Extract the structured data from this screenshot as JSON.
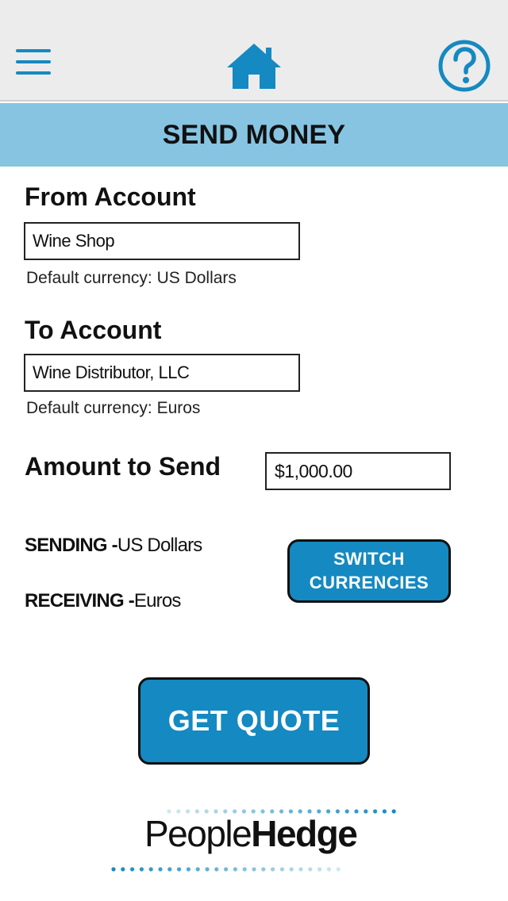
{
  "header": {
    "menu_icon": "hamburger-menu-icon",
    "home_icon": "house-icon",
    "help_icon": "question-mark-circle-icon",
    "icon_color": "#1589c1"
  },
  "title": "SEND MONEY",
  "from_account": {
    "label": "From Account",
    "value": "Wine Shop",
    "hint": "Default currency: US Dollars"
  },
  "to_account": {
    "label": "To Account",
    "value": "Wine Distributor, LLC",
    "hint": "Default currency: Euros"
  },
  "amount": {
    "label": "Amount to Send",
    "value": "$1,000.00"
  },
  "currencies": {
    "sending_label": "SENDING -",
    "sending_value": "US Dollars",
    "receiving_label": "RECEIVING -",
    "receiving_value": "Euros"
  },
  "switch_button": {
    "line1": "SWITCH",
    "line2": "CURRENCIES"
  },
  "quote_button": "GET QUOTE",
  "logo": {
    "part1": "People",
    "part2": "Hedge"
  },
  "colors": {
    "accent": "#1589c1",
    "title_bar": "#86c4e2",
    "header_bg": "#ececec"
  }
}
